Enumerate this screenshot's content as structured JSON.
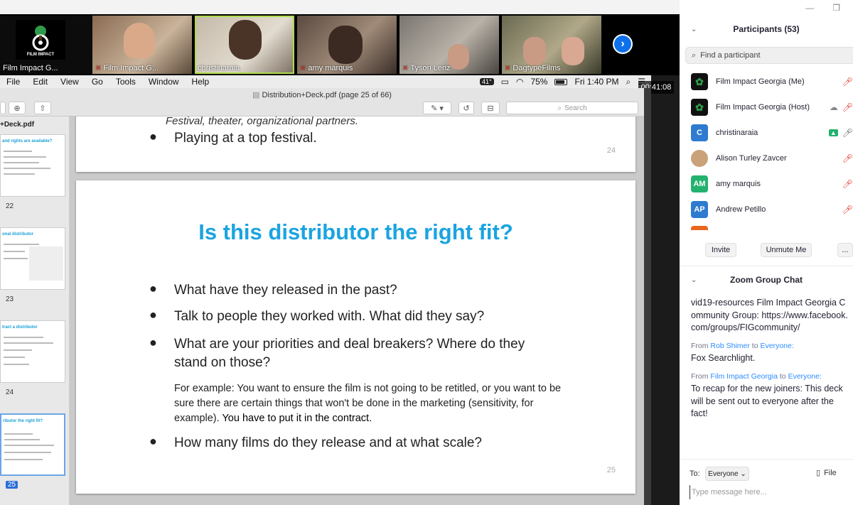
{
  "gallery": {
    "tiles": [
      {
        "name": "Film Impact G...",
        "muted": true
      },
      {
        "name": "Film Impact G...",
        "muted": true
      },
      {
        "name": "christinaraia",
        "muted": false
      },
      {
        "name": "amy marquis",
        "muted": true
      },
      {
        "name": "Tyson Lenz",
        "muted": true
      },
      {
        "name": "DagtypeFilms",
        "muted": true
      }
    ],
    "logo_text": "FILM IMPACT",
    "next_icon": "chevron-right-icon"
  },
  "menubar": {
    "items": [
      "File",
      "Edit",
      "View",
      "Go",
      "Tools",
      "Window",
      "Help"
    ],
    "weather": "41°",
    "battery": "75%",
    "clock": "Fri 1:40 PM"
  },
  "meeting_timer": "00:41:08",
  "preview": {
    "title": "Distribution+Deck.pdf (page 25 of 66)",
    "search_placeholder": "Search",
    "doc_name": "+Deck.pdf",
    "thumbnails": [
      {
        "title": "and rights are available?",
        "page": "22"
      },
      {
        "title": "onal distributor",
        "page": "23"
      },
      {
        "title": "tract a distributor",
        "page": "24"
      },
      {
        "title": "ributor the right fit?",
        "page": "25"
      }
    ]
  },
  "page24": {
    "partial_line": "Festival, theater, organizational partners.",
    "bullet": "Playing at a top festival.",
    "page_number": "24"
  },
  "page25": {
    "title": "Is this distributor the right fit?",
    "bullets": [
      "What have they released in the past?",
      "Talk to people they worked with.  What did they say?",
      "What are your priorities and deal breakers?  Where do they stand on those?",
      "How many films do they release and at what scale?"
    ],
    "example": "For example: You want to ensure the film is not going to be retitled, or you want to be sure there are certain things that won't be done in the marketing (sensitivity, for example).",
    "example_bold": "You have to put it in the contract.",
    "page_number": "25"
  },
  "participants": {
    "header": "Participants (53)",
    "search_placeholder": "Find a participant",
    "list": [
      {
        "name": "Film Impact Georgia (Me)",
        "avatar": "",
        "avatar_color": "#111111",
        "icons": [
          "mic-muted-icon"
        ]
      },
      {
        "name": "Film Impact Georgia (Host)",
        "avatar": "",
        "avatar_color": "#111111",
        "icons": [
          "cloud-record-icon",
          "mic-muted-icon"
        ]
      },
      {
        "name": "christinaraia",
        "avatar": "C",
        "avatar_color": "#2e7bcf",
        "icons": [
          "screen-share-icon",
          "mic-icon"
        ]
      },
      {
        "name": "Alison Turley Zavcer",
        "avatar": "",
        "avatar_color": "#c9a27a",
        "icons": [
          "mic-muted-icon"
        ]
      },
      {
        "name": "amy marquis",
        "avatar": "AM",
        "avatar_color": "#23b26d",
        "icons": [
          "mic-muted-icon"
        ]
      },
      {
        "name": "Andrew Petillo",
        "avatar": "AP",
        "avatar_color": "#2e7bcf",
        "icons": [
          "mic-muted-icon"
        ]
      }
    ],
    "invite_label": "Invite",
    "unmute_label": "Unmute Me",
    "more_label": "..."
  },
  "chat": {
    "header": "Zoom Group Chat",
    "messages": [
      {
        "from": "",
        "to": "",
        "text": "vid19-resources Film Impact Georgia Community Group: https://www.facebook.com/groups/FIGcommunity/"
      },
      {
        "from": "Rob Shimer",
        "to": "Everyone:",
        "text": "Fox Searchlight."
      },
      {
        "from": "Film Impact Georgia",
        "to": "Everyone:",
        "text": "To recap for the new joiners: This deck will be sent out to everyone after the fact!"
      }
    ],
    "from_prefix": "From",
    "to_word": "to",
    "to_label": "To:",
    "recipient": "Everyone",
    "file_label": "File",
    "input_placeholder": "Type message here..."
  }
}
